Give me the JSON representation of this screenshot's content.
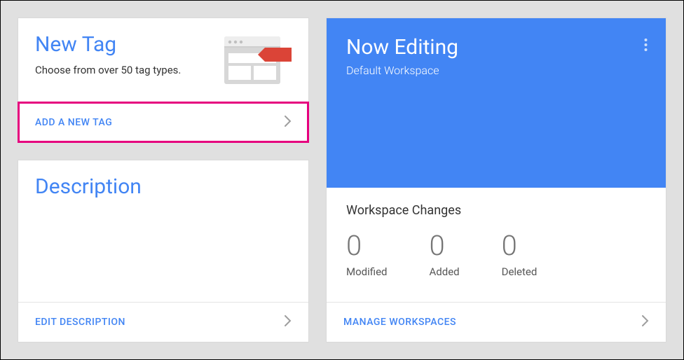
{
  "newTag": {
    "title": "New Tag",
    "subtitle": "Choose from over 50 tag types.",
    "actionLabel": "ADD A NEW TAG"
  },
  "description": {
    "title": "Description",
    "actionLabel": "EDIT DESCRIPTION"
  },
  "editing": {
    "title": "Now Editing",
    "subtitle": "Default Workspace",
    "changesTitle": "Workspace Changes",
    "stats": {
      "modified": {
        "value": "0",
        "label": "Modified"
      },
      "added": {
        "value": "0",
        "label": "Added"
      },
      "deleted": {
        "value": "0",
        "label": "Deleted"
      }
    },
    "actionLabel": "MANAGE WORKSPACES"
  }
}
